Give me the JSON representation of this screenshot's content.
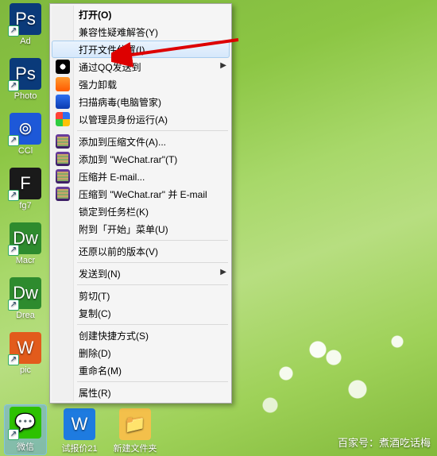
{
  "desktop_left": [
    {
      "label": "Ad",
      "color": "#0a3a7a",
      "glyph": "Ps"
    },
    {
      "label": "Photo",
      "color": "#0a3a7a",
      "glyph": "Ps"
    },
    {
      "label": "CCl",
      "color": "#1d58d8",
      "glyph": "⊚"
    },
    {
      "label": "fg7",
      "color": "#1a1a1a",
      "glyph": "F"
    },
    {
      "label": "Macr",
      "color": "#2e8b2e",
      "glyph": "Dw"
    },
    {
      "label": "Drea",
      "color": "#2e8b2e",
      "glyph": "Dw"
    },
    {
      "label": "pic",
      "color": "#e25b1c",
      "glyph": "W"
    }
  ],
  "wechat_selected": {
    "label": "微信",
    "color": "#2dc100",
    "glyph": "💬"
  },
  "desktop_bottom": [
    {
      "label": "试报价21",
      "color": "#1e7be0",
      "glyph": "W"
    },
    {
      "label": "新建文件夹",
      "color": "#f3c04b",
      "glyph": "📁"
    }
  ],
  "watermark": "百家号：煮酒吃话梅",
  "menu": [
    {
      "type": "item",
      "label": "打开(O)",
      "bold": true
    },
    {
      "type": "item",
      "label": "兼容性疑难解答(Y)"
    },
    {
      "type": "item",
      "label": "打开文件位置(I)",
      "hover": true
    },
    {
      "type": "item",
      "label": "通过QQ发送到",
      "icon": "qq",
      "submenu": true
    },
    {
      "type": "item",
      "label": "强力卸载",
      "icon": "uninst"
    },
    {
      "type": "item",
      "label": "扫描病毒(电脑管家)",
      "icon": "shield"
    },
    {
      "type": "item",
      "label": "以管理员身份运行(A)",
      "icon": "admin"
    },
    {
      "type": "sep"
    },
    {
      "type": "item",
      "label": "添加到压缩文件(A)...",
      "icon": "rar"
    },
    {
      "type": "item",
      "label": "添加到 \"WeChat.rar\"(T)",
      "icon": "rar"
    },
    {
      "type": "item",
      "label": "压缩并 E-mail...",
      "icon": "rar"
    },
    {
      "type": "item",
      "label": "压缩到 \"WeChat.rar\" 并 E-mail",
      "icon": "rar"
    },
    {
      "type": "item",
      "label": "锁定到任务栏(K)"
    },
    {
      "type": "item",
      "label": "附到「开始」菜单(U)"
    },
    {
      "type": "sep"
    },
    {
      "type": "item",
      "label": "还原以前的版本(V)"
    },
    {
      "type": "sep"
    },
    {
      "type": "item",
      "label": "发送到(N)",
      "submenu": true
    },
    {
      "type": "sep"
    },
    {
      "type": "item",
      "label": "剪切(T)"
    },
    {
      "type": "item",
      "label": "复制(C)"
    },
    {
      "type": "sep"
    },
    {
      "type": "item",
      "label": "创建快捷方式(S)"
    },
    {
      "type": "item",
      "label": "删除(D)"
    },
    {
      "type": "item",
      "label": "重命名(M)"
    },
    {
      "type": "sep"
    },
    {
      "type": "item",
      "label": "属性(R)"
    }
  ]
}
